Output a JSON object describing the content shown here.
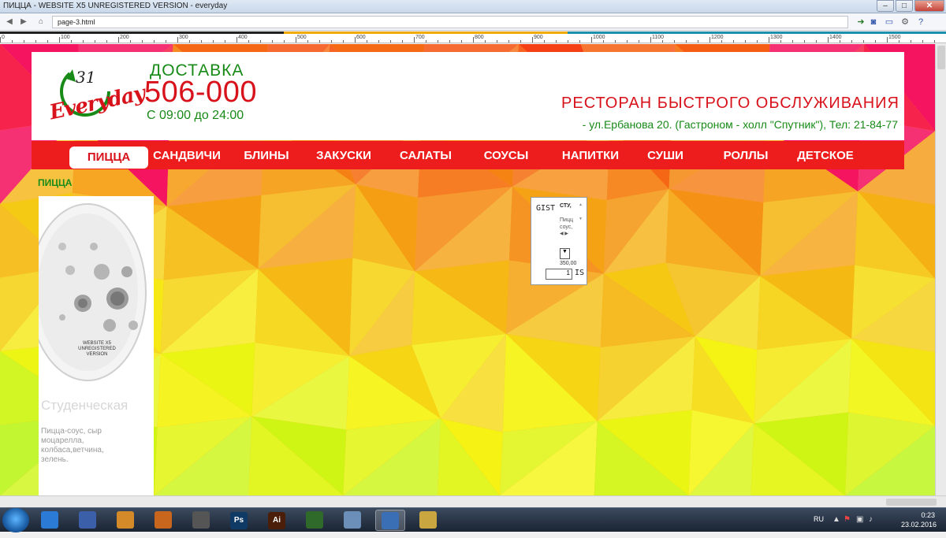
{
  "window": {
    "title": "ПИЦЦА - WEBSITE X5 UNREGISTERED VERSION - everyday",
    "url": "page-3.html"
  },
  "ruler": {
    "labels": [
      "0",
      "100",
      "200",
      "300",
      "400",
      "500",
      "600",
      "700",
      "800",
      "900",
      "1000",
      "1100",
      "1200",
      "1300",
      "1400",
      "1500"
    ]
  },
  "header": {
    "logo_number": "31",
    "logo_text": "Everyday",
    "delivery_label": "ДОСТАВКА",
    "delivery_phone": "506-000",
    "delivery_hours": "С 09:00 до 24:00",
    "restaurant_title": "РЕСТОРАН БЫСТРОГО ОБСЛУЖИВАНИЯ",
    "restaurant_address": "- ул.Ербанова 20. (Гастроном - холл \"Спутник\"), Тел: 21-84-77"
  },
  "menu": {
    "items": [
      {
        "label": "ПИЦЦА"
      },
      {
        "label": "САНДВИЧИ"
      },
      {
        "label": "БЛИНЫ"
      },
      {
        "label": "ЗАКУСКИ"
      },
      {
        "label": "САЛАТЫ"
      },
      {
        "label": "СОУСЫ"
      },
      {
        "label": "НАПИТКИ"
      },
      {
        "label": "СУШИ"
      },
      {
        "label": "РОЛЛЫ"
      },
      {
        "label": "ДЕТСКОЕ"
      }
    ],
    "active_index": 0
  },
  "section": {
    "title": "ПИЦЦА"
  },
  "product": {
    "watermark": "WEBSITE X5 UNREGISTERED VERSION",
    "name": "Студенческая",
    "description": "Пицца-соус, сыр моцарелла, колбаса,ветчина, зелень."
  },
  "widget": {
    "code_label": "GIST",
    "title": "СТУ,",
    "description": "Пицц соус,",
    "price": "350,00",
    "quantity": "1",
    "cart_label": "IS",
    "selector_symbol": "▼"
  },
  "taskbar": {
    "language": "RU",
    "time": "0:23",
    "date": "23.02.2016",
    "apps": [
      {
        "icon": "chrome-icon",
        "label": ""
      },
      {
        "icon": "save-floppy-icon",
        "label": ""
      },
      {
        "icon": "puzzle-app-icon",
        "label": ""
      },
      {
        "icon": "notes-app-icon",
        "label": ""
      },
      {
        "icon": "world-of-tanks-icon",
        "label": ""
      },
      {
        "icon": "photoshop-icon",
        "label": "Ps"
      },
      {
        "icon": "illustrator-icon",
        "label": "Ai"
      },
      {
        "icon": "dreamweaver-icon",
        "label": ""
      },
      {
        "icon": "calculator-icon",
        "label": ""
      },
      {
        "icon": "website-x5-icon",
        "label": ""
      },
      {
        "icon": "folder-icon",
        "label": ""
      }
    ]
  },
  "colors": {
    "brand_red": "#d8121b",
    "brand_green": "#178a17",
    "menu_red": "#ee1d1d"
  }
}
